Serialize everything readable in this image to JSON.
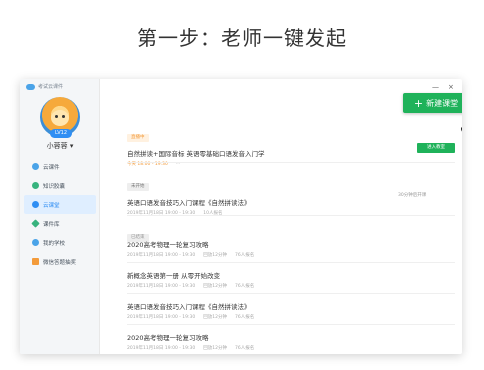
{
  "headline": "第一步：老师一键发起",
  "app": {
    "brand": "考试云课件",
    "user": {
      "level": "LV12",
      "name": "小蓉蓉 ▾"
    },
    "nav": [
      {
        "label": "云课件",
        "color": "#4aa3e8",
        "active": false
      },
      {
        "label": "知识胶囊",
        "color": "#37b37e",
        "active": false
      },
      {
        "label": "云课堂",
        "color": "#2f8ef3",
        "active": true
      },
      {
        "label": "课件库",
        "color": "#37b37e",
        "active": false
      },
      {
        "label": "我的学校",
        "color": "#4aa3e8",
        "active": false
      },
      {
        "label": "微信答题抽奖",
        "color": "#f39b3b",
        "active": false
      }
    ],
    "window": {
      "minimize": "—",
      "close": "×"
    },
    "new_button": {
      "icon": "+",
      "label": "新建课堂"
    },
    "courses": {
      "live": {
        "badge": "直播中",
        "title": "自然拼读+国际音标 英语零基础口语发音入门学",
        "meta": [
          "今天 18:00 - 19:30",
          "..."
        ],
        "enter_label": "进入教室"
      },
      "upcoming": {
        "badge": "未开始",
        "title": "英语口语发音技巧入门课程《自然拼读法》",
        "meta": [
          "2019年11月18日 19:00 - 19:30",
          "10人报名"
        ],
        "note": "30分钟后开课"
      },
      "ended_badge": "已结束",
      "ended": [
        {
          "title": "2020高考物理一轮复习攻略",
          "meta": [
            "2019年11月18日 19:00 - 19:30",
            "回放12分钟",
            "76人报名"
          ]
        },
        {
          "title": "新概念英语第一册 从零开始改变",
          "meta": [
            "2019年11月18日 19:00 - 19:30",
            "回放12分钟",
            "76人报名"
          ]
        },
        {
          "title": "英语口语发音技巧入门课程《自然拼读法》",
          "meta": [
            "2019年11月18日 19:00 - 19:30",
            "回放12分钟",
            "76人报名"
          ]
        },
        {
          "title": "2020高考物理一轮复习攻略",
          "meta": [
            "2019年11月18日 19:00 - 19:30",
            "回放12分钟",
            "76人报名"
          ]
        }
      ]
    }
  }
}
